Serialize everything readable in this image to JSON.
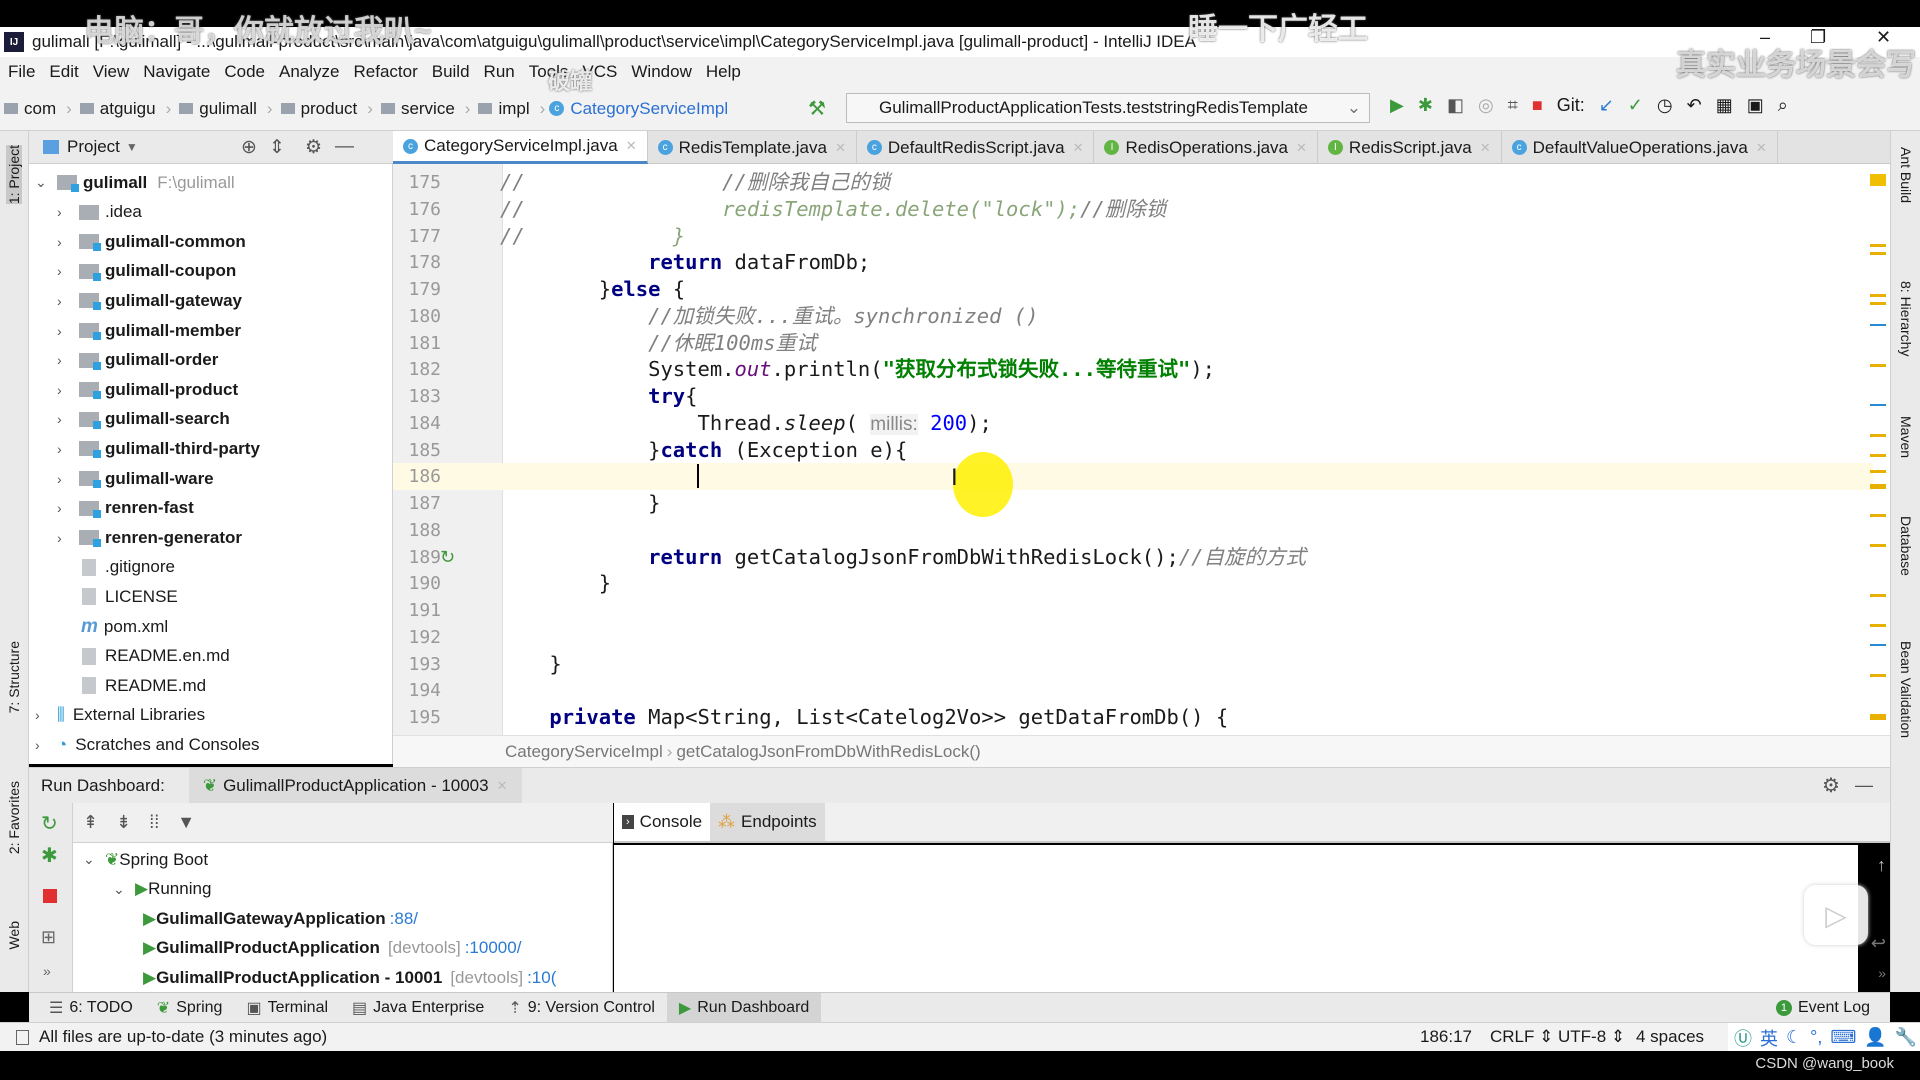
{
  "overlays": {
    "top_left": "电脑：哥，你就放过我叭~",
    "top_center": "睡一下广轻工",
    "top_right": "真实业务场景会写",
    "bottom_right": "CSDN @wang_book",
    "ghost_menu": "破罐"
  },
  "window": {
    "title": "gulimall [F:\\gulimall] - ...\\gulimall-product\\src\\main\\java\\com\\atguigu\\gulimall\\product\\service\\impl\\CategoryServiceImpl.java [gulimall-product] - IntelliJ IDEA",
    "logo": "IJ"
  },
  "menu": [
    "File",
    "Edit",
    "View",
    "Navigate",
    "Code",
    "Analyze",
    "Refactor",
    "Build",
    "Run",
    "Tools",
    "VCS",
    "Window",
    "Help"
  ],
  "breadcrumb": [
    "com",
    "atguigu",
    "gulimall",
    "product",
    "service",
    "impl",
    "CategoryServiceImpl"
  ],
  "run_config": "GulimallProductApplicationTests.teststringRedisTemplate",
  "git_label": "Git:",
  "project_panel": {
    "title": "Project",
    "tool_label": "1: Project"
  },
  "tree": [
    {
      "name": "gulimall",
      "path": "F:\\gulimall",
      "bold": true,
      "expanded": true,
      "depth": 0,
      "type": "module"
    },
    {
      "name": ".idea",
      "depth": 1,
      "type": "folder"
    },
    {
      "name": "gulimall-common",
      "bold": true,
      "depth": 1,
      "type": "module"
    },
    {
      "name": "gulimall-coupon",
      "bold": true,
      "depth": 1,
      "type": "module"
    },
    {
      "name": "gulimall-gateway",
      "bold": true,
      "depth": 1,
      "type": "module"
    },
    {
      "name": "gulimall-member",
      "bold": true,
      "depth": 1,
      "type": "module"
    },
    {
      "name": "gulimall-order",
      "bold": true,
      "depth": 1,
      "type": "module"
    },
    {
      "name": "gulimall-product",
      "bold": true,
      "depth": 1,
      "type": "module"
    },
    {
      "name": "gulimall-search",
      "bold": true,
      "depth": 1,
      "type": "module"
    },
    {
      "name": "gulimall-third-party",
      "bold": true,
      "depth": 1,
      "type": "module"
    },
    {
      "name": "gulimall-ware",
      "bold": true,
      "depth": 1,
      "type": "module"
    },
    {
      "name": "renren-fast",
      "bold": true,
      "depth": 1,
      "type": "module"
    },
    {
      "name": "renren-generator",
      "bold": true,
      "depth": 1,
      "type": "module"
    },
    {
      "name": ".gitignore",
      "depth": 1,
      "type": "file"
    },
    {
      "name": "LICENSE",
      "depth": 1,
      "type": "file"
    },
    {
      "name": "pom.xml",
      "depth": 1,
      "type": "file"
    },
    {
      "name": "README.en.md",
      "depth": 1,
      "type": "file"
    },
    {
      "name": "README.md",
      "depth": 1,
      "type": "file"
    },
    {
      "name": "External Libraries",
      "depth": 0,
      "type": "lib"
    },
    {
      "name": "Scratches and Consoles",
      "depth": 0,
      "type": "lib"
    }
  ],
  "tabs": [
    {
      "label": "CategoryServiceImpl.java",
      "kind": "C",
      "active": true
    },
    {
      "label": "RedisTemplate.java",
      "kind": "C"
    },
    {
      "label": "DefaultRedisScript.java",
      "kind": "C"
    },
    {
      "label": "RedisOperations.java",
      "kind": "I"
    },
    {
      "label": "RedisScript.java",
      "kind": "I"
    },
    {
      "label": "DefaultValueOperations.java",
      "kind": "C"
    }
  ],
  "editor": {
    "current_line": 186,
    "lines": [
      {
        "n": "175",
        "t": [
          [
            "//",
            "cm"
          ],
          [
            "                ",
            ""
          ],
          [
            "//删除我自己的锁",
            "cm"
          ]
        ]
      },
      {
        "n": "176",
        "t": [
          [
            "//",
            "cm"
          ],
          [
            "                ",
            ""
          ],
          [
            "redisTemplate.delete(\"lock\");",
            "cg"
          ],
          [
            "//删除锁",
            "cm"
          ]
        ]
      },
      {
        "n": "177",
        "t": [
          [
            "//",
            "cm"
          ],
          [
            "            ",
            ""
          ],
          [
            "}",
            "cg"
          ]
        ]
      },
      {
        "n": "178",
        "t": [
          [
            "            ",
            ""
          ],
          [
            "return",
            "kw"
          ],
          [
            " dataFromDb;",
            ""
          ]
        ]
      },
      {
        "n": "179",
        "t": [
          [
            "        }",
            ""
          ],
          [
            "else",
            "kw"
          ],
          [
            " {",
            ""
          ]
        ]
      },
      {
        "n": "180",
        "t": [
          [
            "            ",
            ""
          ],
          [
            "//加锁失败...重试。synchronized ()",
            "cm"
          ]
        ]
      },
      {
        "n": "181",
        "t": [
          [
            "            ",
            ""
          ],
          [
            "//休眠100ms重试",
            "cm"
          ]
        ]
      },
      {
        "n": "182",
        "t": [
          [
            "            System.",
            ""
          ],
          [
            "out",
            "fld"
          ],
          [
            ".println(",
            ""
          ],
          [
            "\"获取分布式锁失败...等待重试\"",
            "str"
          ],
          [
            ");",
            ""
          ]
        ]
      },
      {
        "n": "183",
        "t": [
          [
            "            ",
            ""
          ],
          [
            "try",
            "kw"
          ],
          [
            "{",
            ""
          ]
        ]
      },
      {
        "n": "184",
        "t": [
          [
            "                Thread.",
            ""
          ],
          [
            "sleep",
            "it"
          ],
          [
            "( ",
            ""
          ],
          [
            "millis:",
            "hint"
          ],
          [
            " ",
            ""
          ],
          [
            "200",
            "num"
          ],
          [
            ");",
            ""
          ]
        ]
      },
      {
        "n": "185",
        "t": [
          [
            "            }",
            ""
          ],
          [
            "catch",
            "kw"
          ],
          [
            " (Exception e){",
            ""
          ]
        ]
      },
      {
        "n": "186",
        "t": [
          [
            "",
            ""
          ]
        ]
      },
      {
        "n": "187",
        "t": [
          [
            "            }",
            ""
          ]
        ]
      },
      {
        "n": "188",
        "t": [
          [
            "",
            ""
          ]
        ]
      },
      {
        "n": "189",
        "t": [
          [
            "            ",
            ""
          ],
          [
            "return",
            "kw"
          ],
          [
            " getCatalogJsonFromDbWithRedisLock();",
            ""
          ],
          [
            "//自旋的方式",
            "cm"
          ]
        ]
      },
      {
        "n": "190",
        "t": [
          [
            "        }",
            ""
          ]
        ]
      },
      {
        "n": "191",
        "t": [
          [
            "",
            ""
          ]
        ]
      },
      {
        "n": "192",
        "t": [
          [
            "",
            ""
          ]
        ]
      },
      {
        "n": "193",
        "t": [
          [
            "    }",
            ""
          ]
        ]
      },
      {
        "n": "194",
        "t": [
          [
            "",
            ""
          ]
        ]
      },
      {
        "n": "195",
        "t": [
          [
            "    ",
            ""
          ],
          [
            "private",
            "kw"
          ],
          [
            " Map<String, List<Catelog2Vo>> getDataFromDb() {",
            ""
          ]
        ]
      }
    ],
    "breadcrumb": [
      "CategoryServiceImpl",
      "getCatalogJsonFromDbWithRedisLock()"
    ]
  },
  "right_tools": [
    "Ant Build",
    "8: Hierarchy",
    "Maven",
    "Database",
    "Bean Validation"
  ],
  "left_tools": [
    "1: Project",
    "7: Structure",
    "2: Favorites",
    "Web"
  ],
  "run_dashboard": {
    "label": "Run Dashboard:",
    "tab": "GulimallProductApplication - 10003",
    "tree": [
      {
        "name": "Spring Boot",
        "depth": 0
      },
      {
        "name": "Running",
        "depth": 1
      },
      {
        "name": "GulimallGatewayApplication",
        "depth": 2,
        "bold": true,
        "tag": "",
        "port": ":88/"
      },
      {
        "name": "GulimallProductApplication",
        "depth": 2,
        "bold": true,
        "tag": "[devtools]",
        "port": ":10000/"
      },
      {
        "name": "GulimallProductApplication - 10001",
        "depth": 2,
        "bold": true,
        "tag": "[devtools]",
        "port": ":10("
      }
    ],
    "console_tabs": [
      "Console",
      "Endpoints"
    ]
  },
  "bottom_tabs": [
    "6: TODO",
    "Spring",
    "Terminal",
    "Java Enterprise",
    "9: Version Control",
    "Run Dashboard"
  ],
  "event_log": {
    "label": "Event Log",
    "count": "1"
  },
  "status": {
    "message": "All files are up-to-date (3 minutes ago)",
    "position": "186:17",
    "line_sep": "CRLF",
    "encoding": "UTF-8",
    "indent": "4 spaces",
    "ime": "英"
  },
  "colors": {
    "accent": "#4a88c7",
    "keyword": "#000080",
    "string": "#008000",
    "comment": "#808080",
    "current_line": "#fffae3"
  }
}
